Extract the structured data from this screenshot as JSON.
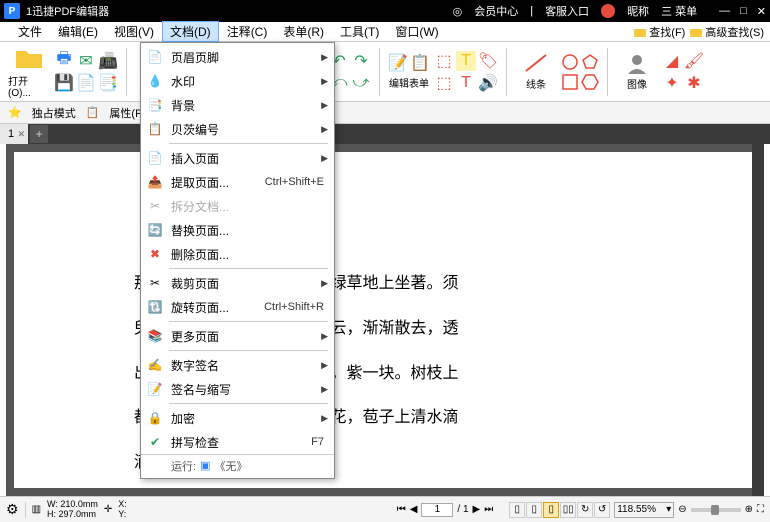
{
  "titlebar": {
    "app_icon_letter": "P",
    "title": "1迅捷PDF编辑器",
    "member_center": "会员中心",
    "support": "客服入口",
    "nickname": "昵称",
    "menu_btn": "三 菜单"
  },
  "menubar": {
    "items": [
      {
        "label": "文件"
      },
      {
        "label": "编辑(E)"
      },
      {
        "label": "视图(V)"
      },
      {
        "label": "文档(D)",
        "active": true
      },
      {
        "label": "注释(C)"
      },
      {
        "label": "表单(R)"
      },
      {
        "label": "工具(T)"
      },
      {
        "label": "窗口(W)"
      }
    ],
    "find": "查找(F)",
    "adv_find": "高级查找(S)"
  },
  "toolbar": {
    "open": "打开(O)...",
    "edit_form": "编辑表单",
    "lines": "线条",
    "image": "图像"
  },
  "secbar": {
    "exclusive": "独占模式",
    "properties": "属性(P)..."
  },
  "tabs": {
    "tab1": "1"
  },
  "dropdown": {
    "items": [
      {
        "icon": "📄",
        "label": "页眉页脚",
        "arrow": true
      },
      {
        "icon": "💧",
        "label": "水印",
        "arrow": true
      },
      {
        "icon": "📑",
        "label": "背景",
        "arrow": true
      },
      {
        "icon": "📋",
        "label": "贝茨编号",
        "arrow": true
      },
      {
        "sep": true
      },
      {
        "icon": "➕",
        "label": "插入页面",
        "arrow": true
      },
      {
        "icon": "📤",
        "label": "提取页面...",
        "shortcut": "Ctrl+Shift+E"
      },
      {
        "icon": "✂",
        "label": "拆分文档...",
        "disabled": true
      },
      {
        "icon": "🔄",
        "label": "替换页面..."
      },
      {
        "icon": "✖",
        "label": "删除页面..."
      },
      {
        "sep": true
      },
      {
        "icon": "✂",
        "label": "裁剪页面",
        "arrow": true
      },
      {
        "icon": "🔃",
        "label": "旋转页面...",
        "shortcut": "Ctrl+Shift+R"
      },
      {
        "sep": true
      },
      {
        "icon": "📚",
        "label": "更多页面",
        "arrow": true
      },
      {
        "sep": true
      },
      {
        "icon": "✍",
        "label": "数字签名",
        "arrow": true
      },
      {
        "icon": "📝",
        "label": "签名与缩写",
        "arrow": true
      },
      {
        "sep": true
      },
      {
        "icon": "🔒",
        "label": "加密",
        "arrow": true
      },
      {
        "icon": "✔",
        "label": "拼写检查",
        "shortcut": "F7"
      }
    ],
    "run_label": "运行:",
    "run_value": "《无》"
  },
  "document": {
    "lines": [
      "那                                          田躁。王冕放牛倦了，在绿草地上坐著。须",
      "臾                                          了。那黑云边上，镶著白云，渐渐散去，透",
      "出                                          通红。湖边山上，青一块，紫一块。树枝上",
      "都                                          得可爱。湖里有十来枝荷花，苞子上清水滴",
      "滴"
    ]
  },
  "statusbar": {
    "width": "W: 210.0mm",
    "height": "H: 297.0mm",
    "x": "X:",
    "y": "Y:",
    "page_current": "1",
    "page_total": "/ 1",
    "zoom": "118.55%"
  }
}
